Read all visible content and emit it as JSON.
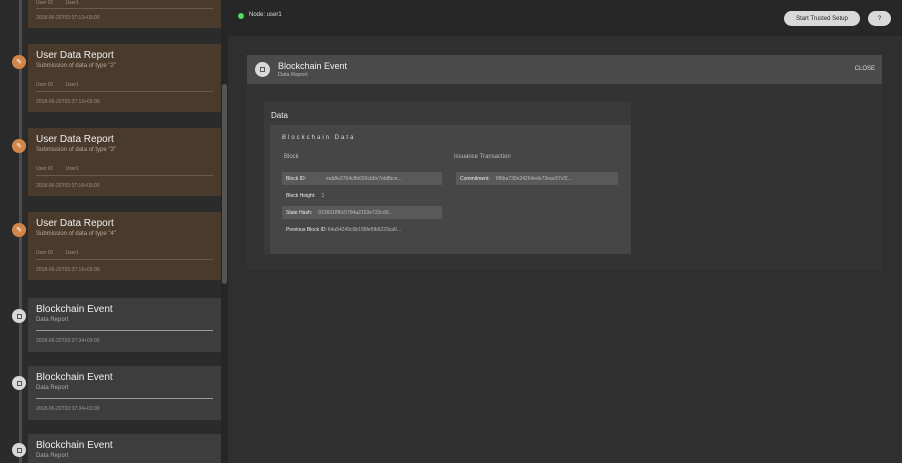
{
  "sidebar": {
    "top_card": {
      "row_key": "User ID",
      "row_val": "User1",
      "date": "2018-06-20T03:37:13+03:00"
    },
    "cards": [
      {
        "type": "user",
        "title": "User Data Report",
        "subtitle": "Submission of data of type \"2\"",
        "row_key": "User ID",
        "row_val": "User1",
        "date": "2018-06-20T03:37:13+03:00"
      },
      {
        "type": "user",
        "title": "User Data Report",
        "subtitle": "Submission of data of type \"3\"",
        "row_key": "User ID",
        "row_val": "User1",
        "date": "2018-06-20T03:37:16+03:00"
      },
      {
        "type": "user",
        "title": "User Data Report",
        "subtitle": "Submission of data of type \"4\"",
        "row_key": "User ID",
        "row_val": "User1",
        "date": "2018-06-20T03:37:16+03:00"
      },
      {
        "type": "event",
        "title": "Blockchain Event",
        "subtitle": "Data Report",
        "date": "2018-06-20T03:37:34+03:00"
      },
      {
        "type": "event",
        "title": "Blockchain Event",
        "subtitle": "Data Report",
        "date": "2018-06-20T03:37:34+03:00"
      },
      {
        "type": "event",
        "title": "Blockchain Event",
        "subtitle": "Data Report"
      }
    ]
  },
  "topbar": {
    "node_label": "Node: user1",
    "setup_button": "Start Trusted Setup",
    "help_button": "?"
  },
  "panel": {
    "title": "Blockchain Event",
    "subtitle": "Data Report",
    "close_label": "CLOSE",
    "data_title": "Data",
    "section_title": "Blockchain Data",
    "block_head": "Block",
    "issuance_head": "Issuance Transaction",
    "block": {
      "block_id_label": "Block ID:",
      "block_id_value": "eab8e2754c8b693cb5e7eb8bce...",
      "block_height_label": "Block Height:",
      "block_height_value": "1",
      "state_hash_label": "State Hash:",
      "state_hash_value": "0136918f6c5784a2163e732cd3...",
      "prev_block_label": "Previous Block ID:",
      "prev_block_value": "64a54245c0b195fe5fb6223ca0..."
    },
    "issuance": {
      "commitment_label": "Commitment:",
      "commitment_value": "9f6ba730e24264ede73eac67cf2..."
    }
  },
  "colors": {
    "accent_orange": "#d2864a",
    "node_green": "#4cd964"
  }
}
